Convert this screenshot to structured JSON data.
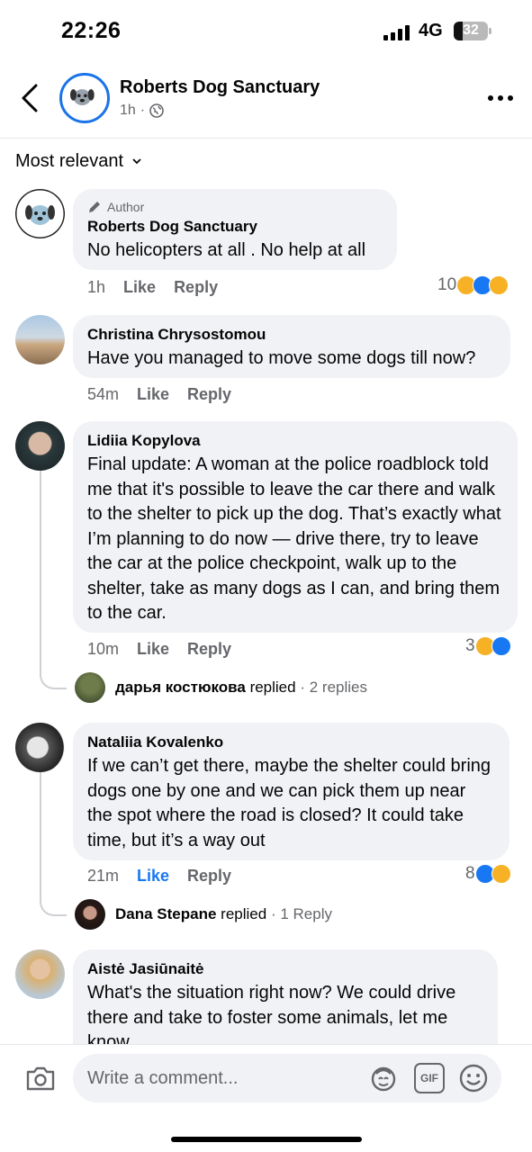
{
  "status_bar": {
    "time": "22:26",
    "network": "4G",
    "battery": "32"
  },
  "header": {
    "page_name": "Roberts Dog Sanctuary",
    "post_age": "1h",
    "dot": "·"
  },
  "sort": {
    "label": "Most relevant"
  },
  "comments": [
    {
      "author_tag": "Author",
      "name": "Roberts Dog Sanctuary",
      "text": "No helicopters at all . No help at all",
      "time": "1h",
      "like": "Like",
      "reply": "Reply",
      "reaction_count": "10",
      "reactions": [
        "sad",
        "like",
        "care"
      ]
    },
    {
      "name": "Christina Chrysostomou",
      "text": "Have you managed to move some dogs till now?",
      "time": "54m",
      "like": "Like",
      "reply": "Reply"
    },
    {
      "name": "Lidiia Kopylova",
      "text": "Final update: A woman at the police roadblock told me that it's possible to leave the car there and walk to the shelter to pick up the dog. That’s exactly what I’m planning to do now — drive there, try to leave the car at the police checkpoint, walk up to the shelter, take as many dogs as I can, and bring them to the car.",
      "time": "10m",
      "like": "Like",
      "reply": "Reply",
      "reaction_count": "3",
      "reactions": [
        "care",
        "like"
      ],
      "replied_by": "дарья костюкова",
      "replied_word": "replied",
      "reply_count": "· 2 replies"
    },
    {
      "name": "Nataliia Kovalenko",
      "text": "If we can’t get there, maybe the shelter could bring dogs one by one and we can pick them up near the spot where the road is closed? It could take time, but it’s a way out",
      "time": "21m",
      "like": "Like",
      "reply": "Reply",
      "reaction_count": "8",
      "reactions": [
        "like",
        "care"
      ],
      "replied_by": "Dana Stepane",
      "replied_word": "replied",
      "reply_count": "· 1 Reply"
    },
    {
      "name": "Aistė Jasiūnaitė",
      "text": "What's the situation right now? We could drive there and take to foster some animals, let me know"
    }
  ],
  "composer": {
    "placeholder": "Write a comment...",
    "gif_label": "GIF"
  },
  "colors": {
    "accent": "#1877f2",
    "bubble": "#f0f2f5",
    "secondary_text": "#65676b"
  }
}
